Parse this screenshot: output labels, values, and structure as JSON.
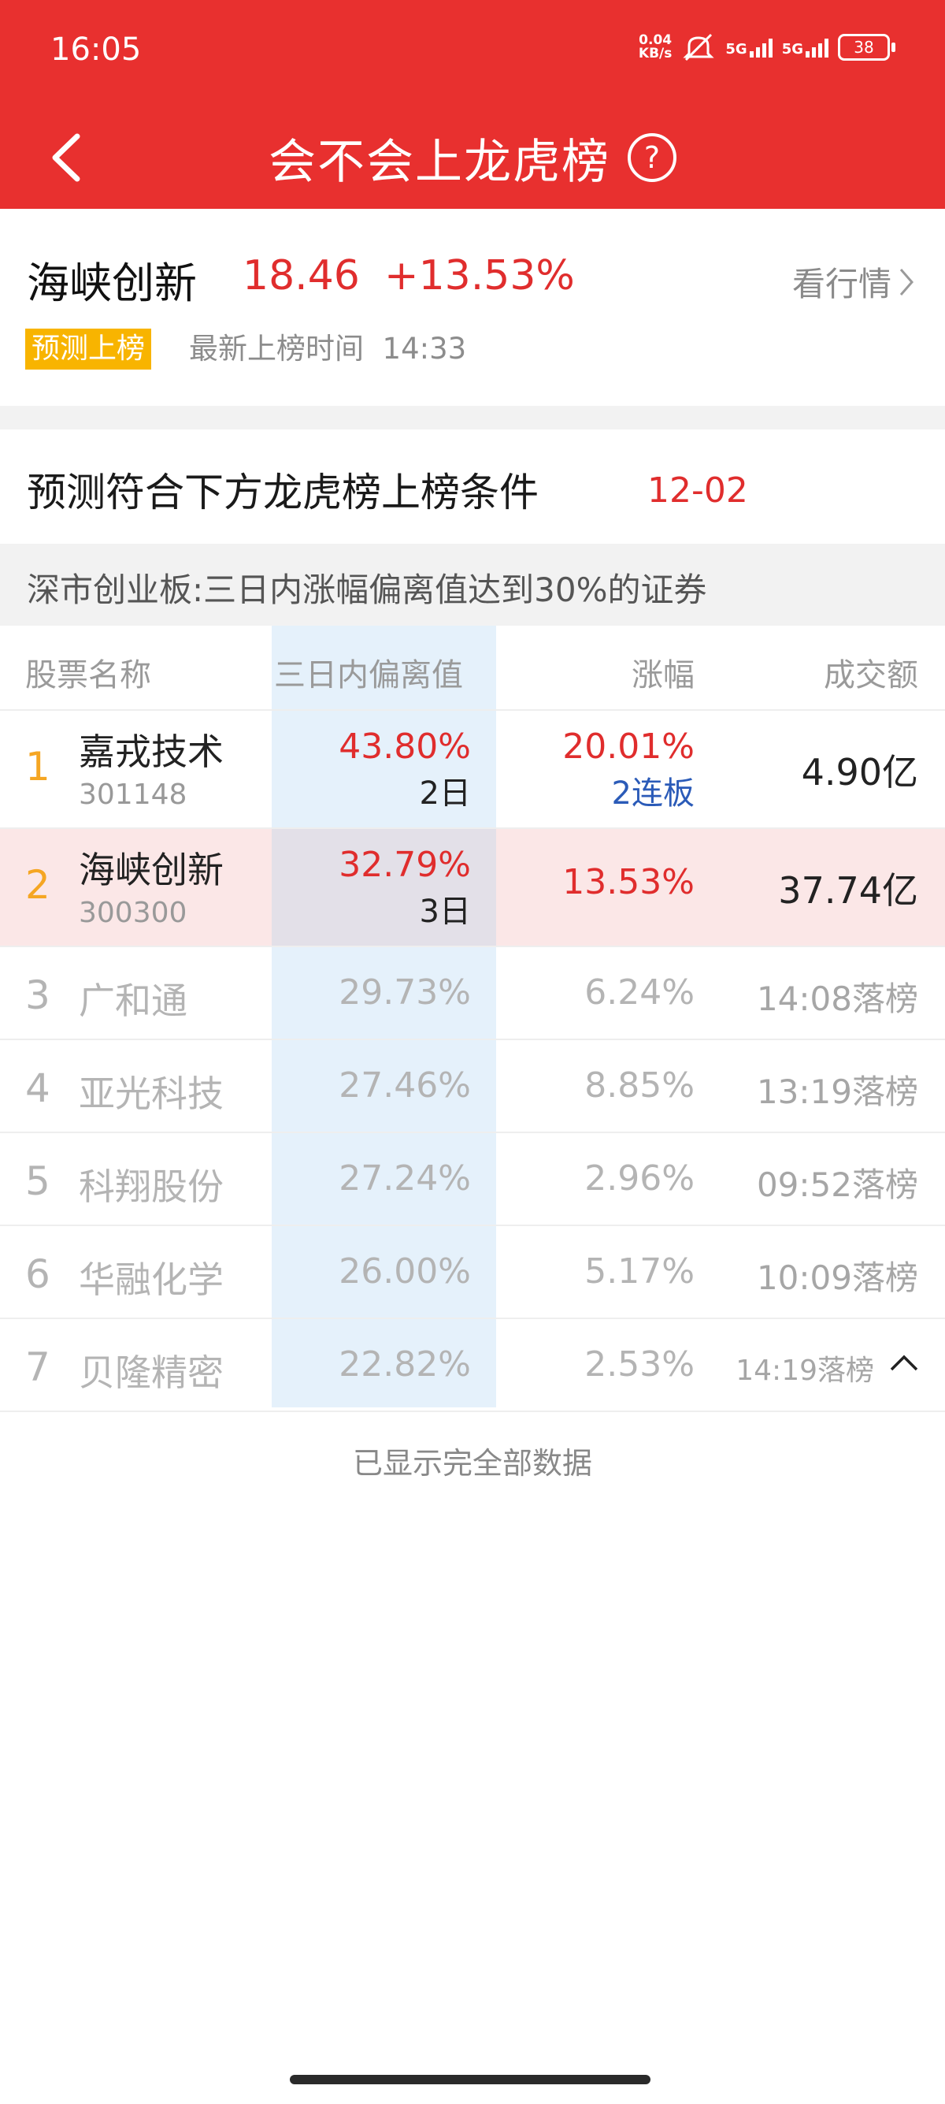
{
  "status": {
    "time": "16:05",
    "net_speed_top": "0.04",
    "net_speed_bottom": "KB/s",
    "net1": "5G",
    "net2": "5G",
    "battery": "38"
  },
  "nav": {
    "title": "会不会上龙虎榜",
    "help": "?"
  },
  "stock": {
    "name": "海峡创新",
    "price": "18.46",
    "change": "+13.53%",
    "view_quote": "看行情",
    "tag": "预测上榜",
    "latest_label": "最新上榜时间",
    "latest_time": "14:33"
  },
  "condition": {
    "title": "预测符合下方龙虎榜上榜条件",
    "date": "12-02",
    "rule": "深市创业板:三日内涨幅偏离值达到30%的证券"
  },
  "table": {
    "headers": {
      "name": "股票名称",
      "deviation": "三日内偏离值",
      "change": "涨幅",
      "amount": "成交额"
    },
    "rows": [
      {
        "rank": "1",
        "name": "嘉戎技术",
        "code": "301148",
        "deviation": "43.80%",
        "days": "2日",
        "change": "20.01%",
        "streak": "2连板",
        "amount": "4.90亿"
      },
      {
        "rank": "2",
        "name": "海峡创新",
        "code": "300300",
        "deviation": "32.79%",
        "days": "3日",
        "change": "13.53%",
        "amount": "37.74亿"
      },
      {
        "rank": "3",
        "name": "广和通",
        "deviation": "29.73%",
        "change": "6.24%",
        "amount": "14:08落榜"
      },
      {
        "rank": "4",
        "name": "亚光科技",
        "deviation": "27.46%",
        "change": "8.85%",
        "amount": "13:19落榜"
      },
      {
        "rank": "5",
        "name": "科翔股份",
        "deviation": "27.24%",
        "change": "2.96%",
        "amount": "09:52落榜"
      },
      {
        "rank": "6",
        "name": "华融化学",
        "deviation": "26.00%",
        "change": "5.17%",
        "amount": "10:09落榜"
      },
      {
        "rank": "7",
        "name": "贝隆精密",
        "deviation": "22.82%",
        "change": "2.53%",
        "amount": "14:19落榜"
      }
    ]
  },
  "footer": {
    "note": "已显示完全部数据"
  },
  "colors": {
    "brand_red": "#e8302f",
    "rise_red": "#e02d2d",
    "tag_yellow": "#f8b400",
    "column_blue": "#e5f1fb",
    "streak_blue": "#2b5bb8"
  }
}
